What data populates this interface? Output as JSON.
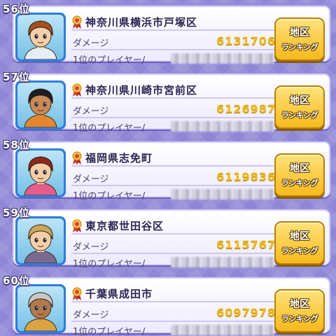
{
  "entries": [
    {
      "rank": "56位",
      "region": "神奈川県横浜市戸塚区",
      "damage_label": "ダメージ",
      "damage": "6131706",
      "player_label": "1位のプレイヤー/",
      "button_line1": "地区",
      "button_line2": "ランキング",
      "avatar": {
        "hair": "#a3501f",
        "skin": "#f6cfa8",
        "shirt": "#e8eef5"
      }
    },
    {
      "rank": "57位",
      "region": "神奈川県川崎市宮前区",
      "damage_label": "ダメージ",
      "damage": "6126987",
      "player_label": "1位のプレイヤー/",
      "button_line1": "地区",
      "button_line2": "ランキング",
      "avatar": {
        "hair": "#1d1d24",
        "skin": "#c98a55",
        "shirt": "#e3872e"
      }
    },
    {
      "rank": "58位",
      "region": "福岡県志免町",
      "damage_label": "ダメージ",
      "damage": "6119836",
      "player_label": "1位のプレイヤー/",
      "button_line1": "地区",
      "button_line2": "ランキング",
      "avatar": {
        "hair": "#8c2a1f",
        "skin": "#f6cfa8",
        "shirt": "#e35d8a"
      }
    },
    {
      "rank": "59位",
      "region": "東京都世田谷区",
      "damage_label": "ダメージ",
      "damage": "6115767",
      "player_label": "1位のプレイヤー/",
      "button_line1": "地区",
      "button_line2": "ランキング",
      "avatar": {
        "hair": "#c9a85a",
        "skin": "#f6cfa8",
        "shirt": "#7a6a8e"
      }
    },
    {
      "rank": "60位",
      "region": "千葉県成田市",
      "damage_label": "ダメージ",
      "damage": "6097978",
      "player_label": "1位のプレイヤー/",
      "button_line1": "地区",
      "button_line2": "ランキング",
      "avatar": {
        "hair": "#c8c8c8",
        "skin": "#b27a4c",
        "shirt": "#d9a441"
      }
    }
  ],
  "icons": {
    "medal": "medal-icon"
  },
  "colors": {
    "background": "#8f86d6",
    "card": "#f5f3ff",
    "damage_gold": "#f1ba1d",
    "button_gold": "#f7b91c",
    "avatar_frame": "#2d7ed8"
  }
}
